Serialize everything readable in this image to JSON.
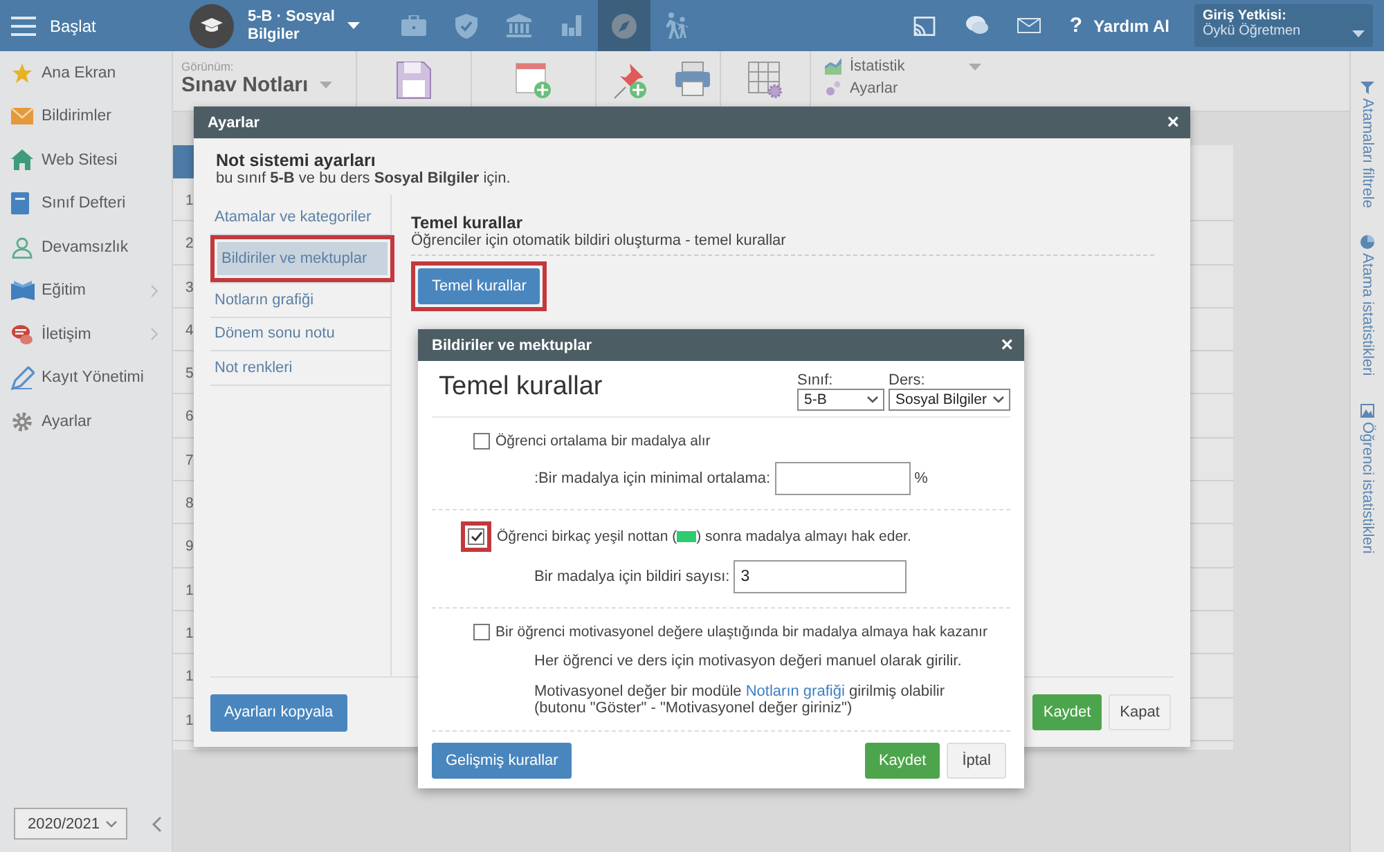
{
  "topbar": {
    "menu_label": "Başlat",
    "course": "5-B · Sosyal Bilgiler",
    "apps": [
      {
        "selected": false
      },
      {
        "selected": false
      },
      {
        "selected": false
      },
      {
        "selected": false
      },
      {
        "selected": true
      },
      {
        "selected": false
      }
    ],
    "help_mark": "?",
    "help_label": "Yardım Al",
    "login_label": "Giriş Yetkisi:",
    "login_user": "Öykü Öğretmen"
  },
  "sidebar": {
    "items": [
      {
        "label": "Ana Ekran",
        "submenu": false
      },
      {
        "label": "Bildirimler",
        "submenu": false
      },
      {
        "label": "Web Sitesi",
        "submenu": false
      },
      {
        "label": "Sınıf Defteri",
        "submenu": false
      },
      {
        "label": "Devamsızlık",
        "submenu": false
      },
      {
        "label": "Eğitim",
        "submenu": true
      },
      {
        "label": "İletişim",
        "submenu": true
      },
      {
        "label": "Kayıt Yönetimi",
        "submenu": false
      },
      {
        "label": "Ayarlar",
        "submenu": false
      }
    ],
    "year": "2020/2021"
  },
  "toolbar": {
    "view_label": "Görünüm:",
    "view": "Sınav Notları",
    "menu": [
      "İstatistik",
      "Ayarlar"
    ]
  },
  "grade_table": {
    "row_numbers": [
      "1",
      "2",
      "3",
      "4",
      "5",
      "6",
      "7",
      "8",
      "9",
      "1",
      "1",
      "1",
      "1"
    ]
  },
  "right_rail": [
    "Atamaları filtrele",
    "Atama istatistikleri",
    "Öğrenci istatistikleri"
  ],
  "settings_dialog": {
    "title": "Ayarlar",
    "close": "×",
    "heading": "Not sistemi ayarları",
    "subtitle": "bu sınıf **5-B** ve bu ders **Sosyal Bilgiler** için.",
    "nav": [
      {
        "label": "Atamalar ve kategoriler",
        "selected": false,
        "highlighted": false
      },
      {
        "label": "Bildiriler ve mektuplar",
        "selected": true,
        "highlighted": true
      },
      {
        "label": "Notların grafiği",
        "selected": false,
        "highlighted": false
      },
      {
        "label": "Dönem sonu notu",
        "selected": false,
        "highlighted": false
      },
      {
        "label": "Not renkleri",
        "selected": false,
        "highlighted": false
      }
    ],
    "section_title": "Temel kurallar",
    "section_desc": "Öğrenciler için otomatik bildiri oluşturma - temel kurallar",
    "section_button": {
      "label": "Temel kurallar",
      "highlighted": true
    },
    "copy_button": "Ayarları kopyala",
    "save_button": "Kaydet",
    "close_button": "Kapat"
  },
  "rules_dialog": {
    "title": "Bildiriler ve mektuplar",
    "close": "×",
    "heading": "Temel kurallar",
    "class_label": "Sınıf:",
    "class_value": "5-B",
    "subject_label": "Ders:",
    "subject_value": "Sosyal Bilgiler",
    "rules": [
      {
        "label": "Öğrenci ortalama bir madalya alır",
        "checked": false,
        "highlighted": false,
        "field_label": ":Bir madalya için minimal ortalama:",
        "field_unit": "%"
      },
      {
        "label_before": "Öğrenci birkaç yeşil nottan (",
        "color": "#2ecc71",
        "label_after": ") sonra madalya almayı hak eder.",
        "checked": true,
        "highlighted": true,
        "field_label": "Bir madalya için bildiri sayısı:",
        "field_value": "3"
      },
      {
        "label": "Bir öğrenci motivasyonel değere ulaştığında bir madalya almaya hak kazanır",
        "checked": false,
        "highlighted": false,
        "note": "Her öğrenci ve ders için motivasyon değeri manuel olarak girilir.",
        "note2_before": "Motivasyonel değer bir modüle ",
        "note2_link": "Notların grafiği",
        "note2_after": " girilmiş olabilir\n(butonu \"Göster\" - \"Motivasyonel değer giriniz\")"
      }
    ],
    "advanced_button": "Gelişmiş kurallar",
    "save_button": "Kaydet",
    "cancel_button": "İptal"
  }
}
